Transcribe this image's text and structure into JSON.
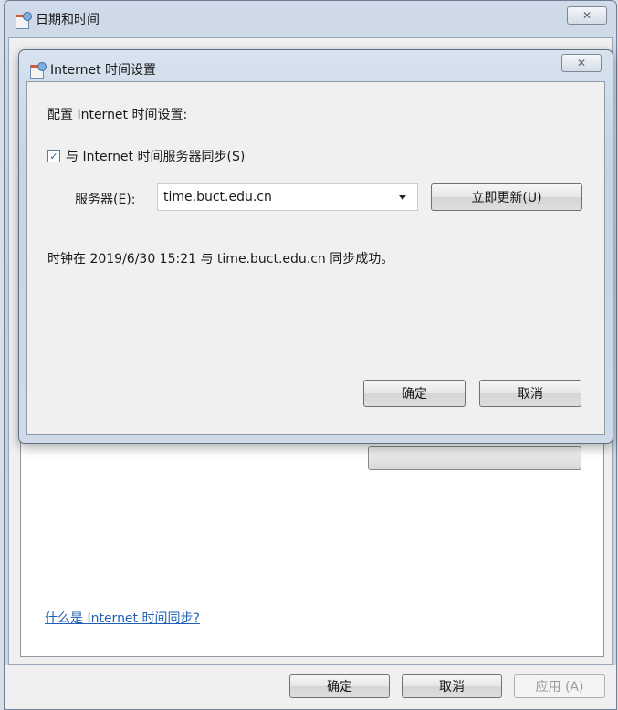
{
  "outer_window": {
    "title": "日期和时间",
    "close_glyph": "✕",
    "help_link": "什么是 Internet 时间同步?",
    "buttons": {
      "ok": "确定",
      "cancel": "取消",
      "apply": "应用 (A)"
    }
  },
  "dialog": {
    "title": "Internet 时间设置",
    "close_glyph": "✕",
    "heading": "配置 Internet 时间设置:",
    "sync_checkbox": {
      "checked": true,
      "check_glyph": "✓",
      "label": "与 Internet 时间服务器同步(S)"
    },
    "server_label": "服务器(E):",
    "server_value": "time.buct.edu.cn",
    "update_now_button": "立即更新(U)",
    "status_text": "时钟在 2019/6/30 15:21 与 time.buct.edu.cn 同步成功。",
    "ok_button": "确定",
    "cancel_button": "取消"
  },
  "icons": [
    "date-time-app-icon",
    "close-icon",
    "checkmark-icon",
    "dropdown-arrow-icon"
  ]
}
